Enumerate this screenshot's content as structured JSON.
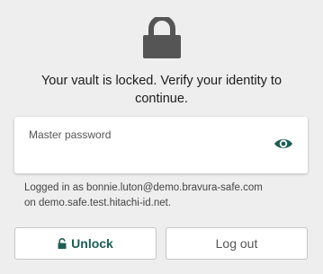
{
  "lock_screen": {
    "message": "Your vault is locked. Verify your identity to continue.",
    "password_field": {
      "label": "Master password",
      "value": "",
      "toggle_icon": "eye-icon"
    },
    "logged_in_text_line1": "Logged in as bonnie.luton@demo.bravura-safe.com",
    "logged_in_text_line2": "on demo.safe.test.hitachi-id.net.",
    "unlock_label": "Unlock",
    "logout_label": "Log out",
    "header_icon": "lock-icon"
  },
  "colors": {
    "background": "#eeeeee",
    "accent": "#1c5e55",
    "lock_icon": "#555555"
  }
}
